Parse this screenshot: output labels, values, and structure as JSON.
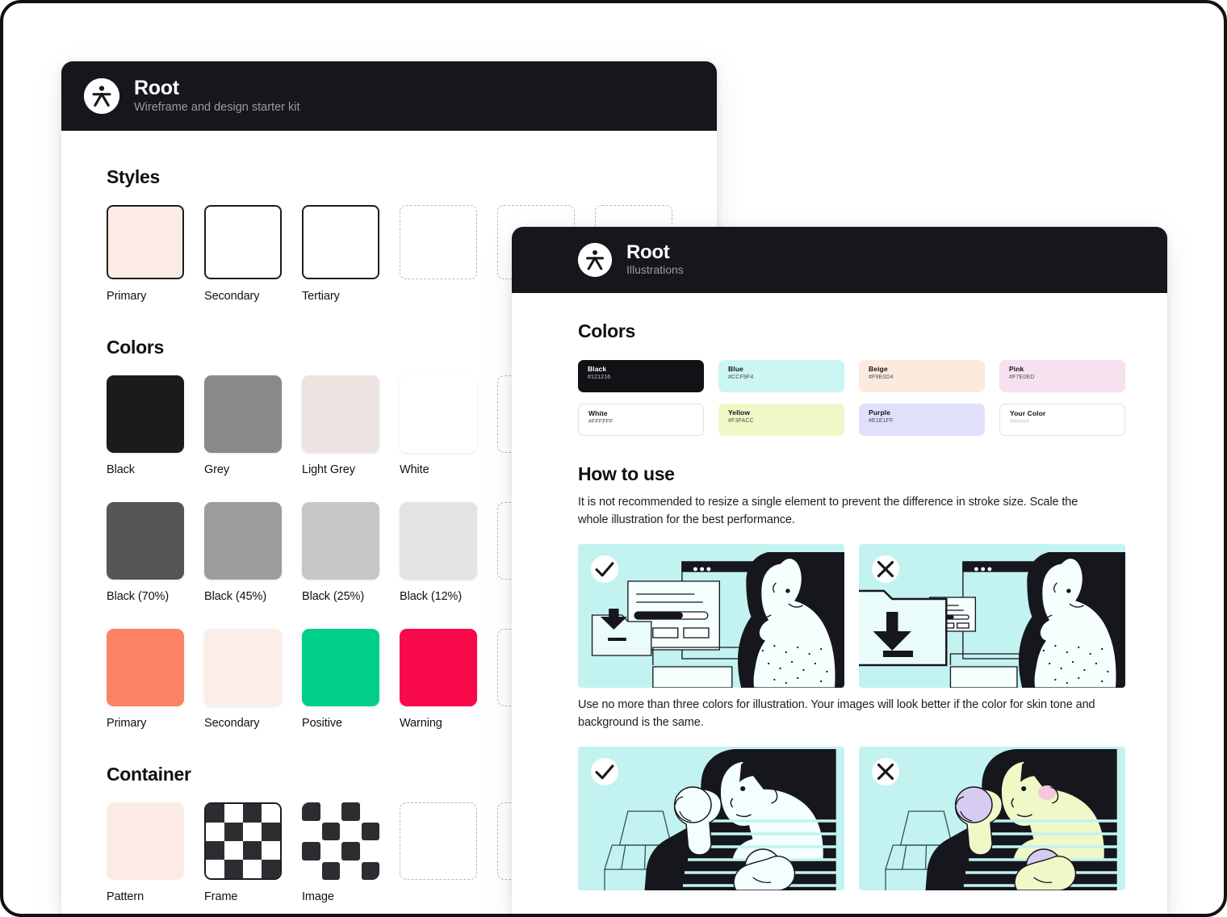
{
  "frame": {
    "background": "#ffffff",
    "border_color": "#111114"
  },
  "cards": {
    "left": {
      "header": {
        "logo_icon": "root-person-logo-icon",
        "title": "Root",
        "subtitle": "Wireframe and design starter kit"
      },
      "sections": [
        {
          "id": "styles",
          "title": "Styles",
          "swatches": [
            {
              "label": "Primary",
              "color": "#fcebe4",
              "kind": "filled-bordered"
            },
            {
              "label": "Secondary",
              "color": "#ffffff",
              "kind": "filled-bordered"
            },
            {
              "label": "Tertiary",
              "color": "#ffffff",
              "kind": "filled-bordered"
            },
            {
              "label": "",
              "color": "",
              "kind": "dashed"
            },
            {
              "label": "",
              "color": "",
              "kind": "dashed"
            },
            {
              "label": "",
              "color": "",
              "kind": "dashed"
            }
          ]
        },
        {
          "id": "colors",
          "title": "Colors",
          "rows": [
            [
              {
                "label": "Black",
                "color": "#1b1b1d",
                "kind": "filled"
              },
              {
                "label": "Grey",
                "color": "#898989",
                "kind": "filled"
              },
              {
                "label": "Light Grey",
                "color": "#ede4e1",
                "kind": "filled"
              },
              {
                "label": "White",
                "color": "#ffffff",
                "kind": "filled"
              },
              {
                "label": "",
                "color": "",
                "kind": "dashed"
              }
            ],
            [
              {
                "label": "Black (70%)",
                "color": "#565656",
                "kind": "filled"
              },
              {
                "label": "Black (45%)",
                "color": "#9d9d9d",
                "kind": "filled"
              },
              {
                "label": "Black (25%)",
                "color": "#c6c6c6",
                "kind": "filled"
              },
              {
                "label": "Black (12%)",
                "color": "#e3e3e3",
                "kind": "filled"
              },
              {
                "label": "",
                "color": "",
                "kind": "dashed"
              }
            ],
            [
              {
                "label": "Primary",
                "color": "#fb8263",
                "kind": "filled"
              },
              {
                "label": "Secondary",
                "color": "#fbeee8",
                "kind": "filled"
              },
              {
                "label": "Positive",
                "color": "#00cf8a",
                "kind": "filled"
              },
              {
                "label": "Warning",
                "color": "#f8094a",
                "kind": "filled"
              },
              {
                "label": "",
                "color": "",
                "kind": "dashed"
              }
            ]
          ]
        },
        {
          "id": "container",
          "title": "Container",
          "swatches": [
            {
              "label": "Pattern",
              "color": "#fcebe4",
              "kind": "filled"
            },
            {
              "label": "Frame",
              "color": "",
              "kind": "checker-framed"
            },
            {
              "label": "Image",
              "color": "",
              "kind": "checker-loose"
            },
            {
              "label": "",
              "color": "",
              "kind": "dashed"
            },
            {
              "label": "",
              "color": "",
              "kind": "dashed"
            }
          ]
        }
      ]
    },
    "right": {
      "header": {
        "logo_icon": "root-person-logo-icon",
        "title": "Root",
        "subtitle": "Illustrations"
      },
      "colors_section": {
        "title": "Colors",
        "chips": [
          {
            "name": "Black",
            "hex": "#121216",
            "bg": "#121216",
            "text": "#ffffff",
            "outline": false
          },
          {
            "name": "Blue",
            "hex": "#CCF9F4",
            "bg": "#ccf6f1",
            "text": "#121216",
            "outline": false
          },
          {
            "name": "Beige",
            "hex": "#F9E0D4",
            "bg": "#fceade",
            "text": "#121216",
            "outline": false
          },
          {
            "name": "Pink",
            "hex": "#F7E0ED",
            "bg": "#f6e1ee",
            "text": "#121216",
            "outline": false
          },
          {
            "name": "White",
            "hex": "#FFFFFF",
            "bg": "#ffffff",
            "text": "#121216",
            "outline": true
          },
          {
            "name": "Yellow",
            "hex": "#F3FACC",
            "bg": "#f1f8c8",
            "text": "#121216",
            "outline": false
          },
          {
            "name": "Purple",
            "hex": "#E1E1FF",
            "bg": "#e0e0fb",
            "text": "#121216",
            "outline": false
          },
          {
            "name": "Your Color",
            "hex": "######",
            "bg": "#ffffff",
            "text": "#121216",
            "outline": true
          }
        ]
      },
      "howto_section": {
        "title": "How to use",
        "paragraph_1": "It is not recommended to resize a single element to prevent the difference in stroke size. Scale the whole illustration for the best performance.",
        "paragraph_2": "Use no more than three colors for illustration. Your images will look better if the color for skin tone and background is the same.",
        "illustrations": [
          {
            "id": "resize-correct",
            "badge": "check-icon",
            "caption_group": 1,
            "bg": "#c2f3f0"
          },
          {
            "id": "resize-wrong",
            "badge": "cross-icon",
            "caption_group": 1,
            "bg": "#c2f3f0"
          },
          {
            "id": "colors-correct",
            "badge": "check-icon",
            "caption_group": 2,
            "bg": "#c2f3f0"
          },
          {
            "id": "colors-wrong",
            "badge": "cross-icon",
            "caption_group": 2,
            "bg": "#c2f3f0"
          }
        ]
      }
    }
  }
}
